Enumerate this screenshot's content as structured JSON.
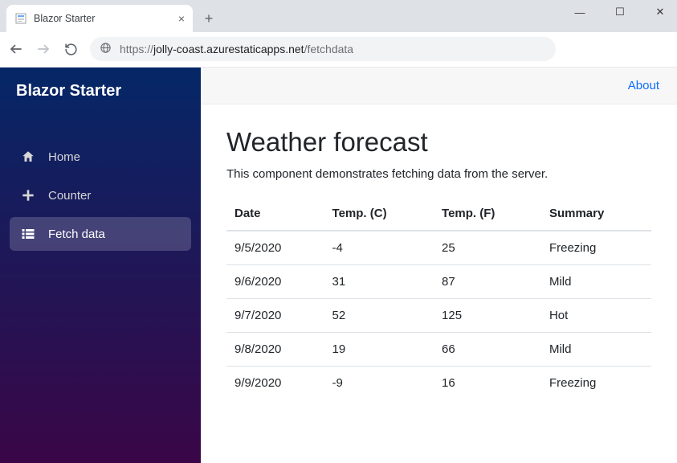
{
  "browser": {
    "tab_title": "Blazor Starter",
    "url_scheme": "https://",
    "url_host": "jolly-coast.azurestaticapps.net",
    "url_path": "/fetchdata"
  },
  "sidebar": {
    "brand": "Blazor Starter",
    "items": [
      {
        "label": "Home"
      },
      {
        "label": "Counter"
      },
      {
        "label": "Fetch data"
      }
    ]
  },
  "topbar": {
    "about_label": "About"
  },
  "page": {
    "heading": "Weather forecast",
    "subtext": "This component demonstrates fetching data from the server."
  },
  "table": {
    "headers": [
      "Date",
      "Temp. (C)",
      "Temp. (F)",
      "Summary"
    ],
    "rows": [
      [
        "9/5/2020",
        "-4",
        "25",
        "Freezing"
      ],
      [
        "9/6/2020",
        "31",
        "87",
        "Mild"
      ],
      [
        "9/7/2020",
        "52",
        "125",
        "Hot"
      ],
      [
        "9/8/2020",
        "19",
        "66",
        "Mild"
      ],
      [
        "9/9/2020",
        "-9",
        "16",
        "Freezing"
      ]
    ]
  }
}
